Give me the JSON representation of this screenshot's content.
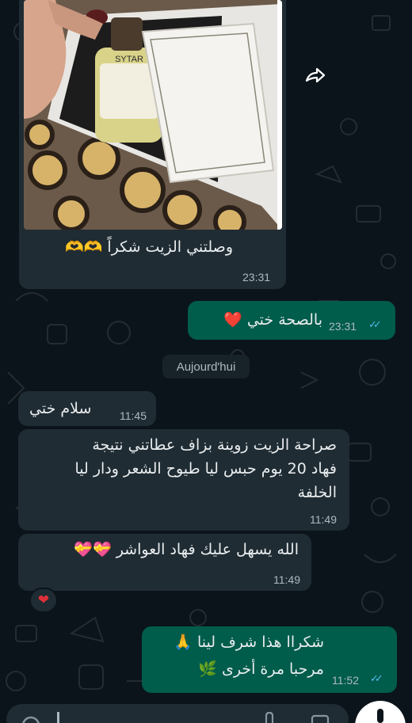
{
  "messages": {
    "photo_caption": "وصلتني الزيت شكراً",
    "photo_caption_emoji": "🫶🫶",
    "photo_time": "23:31",
    "out1_text": "بالصحة ختي",
    "out1_time": "23:31",
    "date_chip": "Aujourd'hui",
    "in1_text": "سلام ختي",
    "in1_time": "11:45",
    "in2_line1": "صراحة الزيت زوينة بزاف عطاتني نتيجة",
    "in2_line2": "فهاد 20 يوم حبس ليا طيوح الشعر ودار ليا",
    "in2_line3": "الخلفة",
    "in2_time": "11:49",
    "in3_text": "الله يسهل عليك فهاد العواشر",
    "in3_emoji": "💝💝",
    "in3_time": "11:49",
    "out2_line1": "شكراا هذا شرف لينا",
    "out2_line2": "مرحبا مرة أخرى",
    "out2_emoji1": "🙏",
    "out2_emoji2": "🌿",
    "out2_time": "11:52"
  },
  "product": {
    "brand": "SYTAR"
  },
  "colors": {
    "background": "#0b141a",
    "incoming": "#202c33",
    "outgoing": "#005c4b",
    "read_ticks": "#53bdeb"
  },
  "icons": [
    "forward-icon",
    "double-check-icon",
    "emoji-icon",
    "attach-icon",
    "camera-icon",
    "mic-icon",
    "heart-reaction-icon"
  ]
}
